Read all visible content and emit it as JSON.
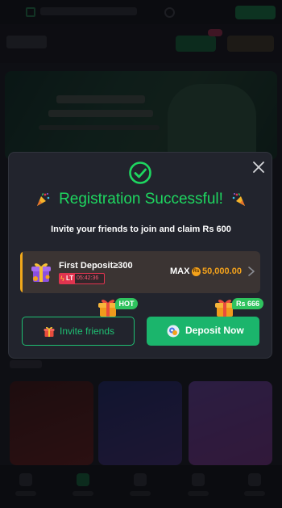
{
  "modal": {
    "title": "Registration Successful!",
    "subtitle": "Invite your friends to join and claim Rs 600",
    "deposit_offer": {
      "label": "First Deposit≥300",
      "badge": "LT",
      "timer": "05:42:36",
      "max_label": "MAX",
      "currency_symbol": "Rs",
      "max_amount": "50,000.00"
    },
    "invite_button": {
      "label": "Invite friends",
      "badge": "HOT"
    },
    "deposit_button": {
      "label": "Deposit Now",
      "badge": "Rs 666"
    }
  },
  "colors": {
    "success_green": "#1ed760",
    "button_green": "#1bb56c",
    "accent_orange": "#f4a21b",
    "timer_red": "#e0344f"
  },
  "icons": [
    "check-circle-icon",
    "party-popper-icon",
    "close-icon",
    "gift-box-icon",
    "lightning-icon",
    "rs-coin-icon",
    "chevron-right-icon",
    "gift-icon",
    "coin-stack-icon"
  ]
}
